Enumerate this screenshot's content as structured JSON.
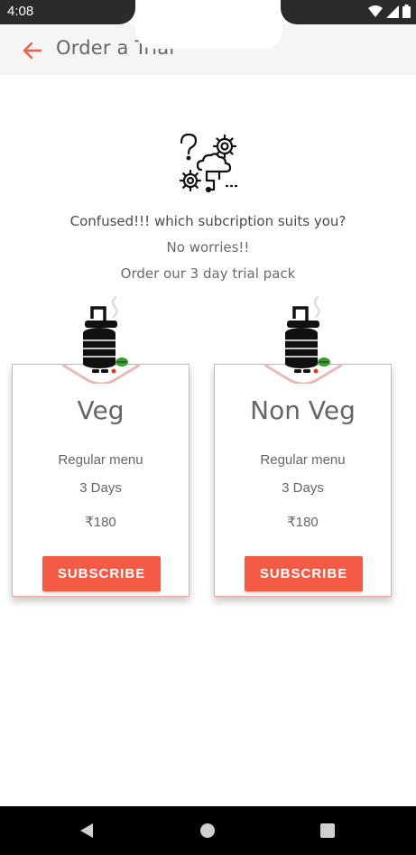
{
  "status_bar": {
    "time": "4:08",
    "icons": [
      "wifi-icon",
      "signal-icon",
      "battery-icon"
    ]
  },
  "app_bar": {
    "title": "Order a Trial",
    "back_icon": "arrow-left-icon",
    "accent_color": "#f45b45"
  },
  "hero": {
    "icon": "confused-gears-icon",
    "question": "Confused!!! which subcription suits you?",
    "line1": "No worries!!",
    "line2": "Order our 3 day trial pack"
  },
  "plans": [
    {
      "name": "Veg",
      "menu": "Regular menu",
      "days": "3 Days",
      "price": "₹180",
      "button_label": "SUBSCRIBE",
      "image": "tiffin-icon"
    },
    {
      "name": "Non Veg",
      "menu": "Regular menu",
      "days": "3 Days",
      "price": "₹180",
      "button_label": "SUBSCRIBE",
      "image": "tiffin-icon"
    }
  ],
  "colors": {
    "button": "#f45b45",
    "card_border": "#f0a7a0",
    "app_bar_bg": "#f5f5f5"
  },
  "nav_bar": {
    "icons": [
      "nav-back-icon",
      "nav-home-icon",
      "nav-recents-icon"
    ]
  }
}
